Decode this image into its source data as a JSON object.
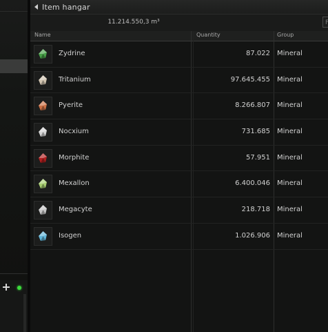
{
  "window": {
    "title": "Item hangar",
    "capacity": "11.214.550,3 m³",
    "filter_placeholder": "F"
  },
  "columns": {
    "name": "Name",
    "quantity": "Quantity",
    "group": "Group"
  },
  "items": [
    {
      "name": "Zydrine",
      "quantity": "87.022",
      "group": "Mineral",
      "icon": "zydrine-icon",
      "color": "#4cae4c"
    },
    {
      "name": "Tritanium",
      "quantity": "97.645.455",
      "group": "Mineral",
      "icon": "tritanium-icon",
      "color": "#e4d6c0"
    },
    {
      "name": "Pyerite",
      "quantity": "8.266.807",
      "group": "Mineral",
      "icon": "pyerite-icon",
      "color": "#e07a4a"
    },
    {
      "name": "Nocxium",
      "quantity": "731.685",
      "group": "Mineral",
      "icon": "nocxium-icon",
      "color": "#e8e8e8"
    },
    {
      "name": "Morphite",
      "quantity": "57.951",
      "group": "Mineral",
      "icon": "morphite-icon",
      "color": "#c02020"
    },
    {
      "name": "Mexallon",
      "quantity": "6.400.046",
      "group": "Mineral",
      "icon": "mexallon-icon",
      "color": "#b6e07a"
    },
    {
      "name": "Megacyte",
      "quantity": "218.718",
      "group": "Mineral",
      "icon": "megacyte-icon",
      "color": "#d8d8d8"
    },
    {
      "name": "Isogen",
      "quantity": "1.026.906",
      "group": "Mineral",
      "icon": "isogen-icon",
      "color": "#6ac8ee"
    }
  ]
}
